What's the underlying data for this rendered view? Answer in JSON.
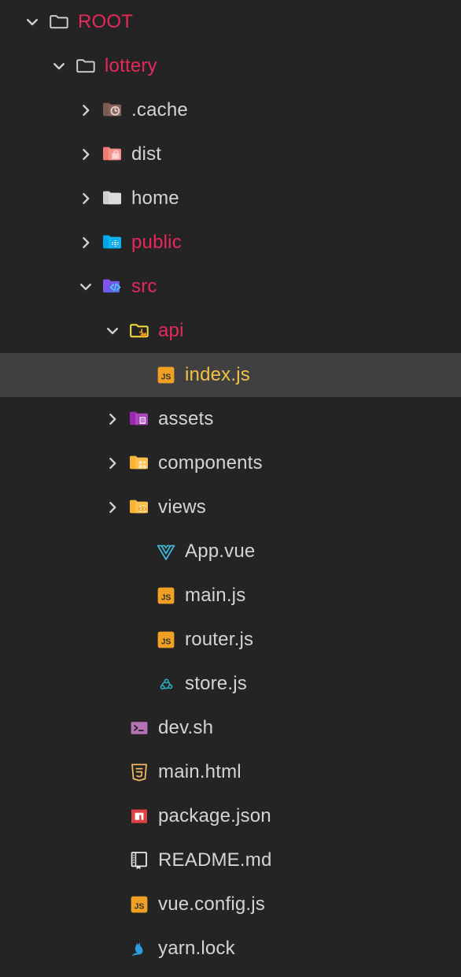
{
  "theme": {
    "background": "#242424",
    "selected_row_background": "#403f42",
    "default_text": "#d4d4d4",
    "folder_text": "#e8275a",
    "selected_file_text": "#f0c244"
  },
  "tree": {
    "name": "file-explorer-tree",
    "rows": [
      {
        "label": "ROOT",
        "depth": 0,
        "kind": "folder",
        "expanded": true,
        "icon": "folder-outline-icon",
        "color": "pink",
        "selected": false
      },
      {
        "label": "lottery",
        "depth": 1,
        "kind": "folder",
        "expanded": true,
        "icon": "folder-outline-icon",
        "color": "pink",
        "selected": false
      },
      {
        "label": ".cache",
        "depth": 2,
        "kind": "folder",
        "expanded": false,
        "icon": "folder-cache-icon",
        "color": "default",
        "selected": false
      },
      {
        "label": "dist",
        "depth": 2,
        "kind": "folder",
        "expanded": false,
        "icon": "folder-dist-icon",
        "color": "default",
        "selected": false
      },
      {
        "label": "home",
        "depth": 2,
        "kind": "folder",
        "expanded": false,
        "icon": "folder-plain-icon",
        "color": "default",
        "selected": false
      },
      {
        "label": "public",
        "depth": 2,
        "kind": "folder",
        "expanded": false,
        "icon": "folder-public-icon",
        "color": "pink",
        "selected": false
      },
      {
        "label": "src",
        "depth": 2,
        "kind": "folder",
        "expanded": true,
        "icon": "folder-src-icon",
        "color": "pink",
        "selected": false
      },
      {
        "label": "api",
        "depth": 3,
        "kind": "folder",
        "expanded": true,
        "icon": "folder-api-icon",
        "color": "pink",
        "selected": false
      },
      {
        "label": "index.js",
        "depth": 4,
        "kind": "file",
        "expanded": null,
        "icon": "javascript-file-icon",
        "color": "gold",
        "selected": true
      },
      {
        "label": "assets",
        "depth": 3,
        "kind": "folder",
        "expanded": false,
        "icon": "folder-assets-icon",
        "color": "default",
        "selected": false
      },
      {
        "label": "components",
        "depth": 3,
        "kind": "folder",
        "expanded": false,
        "icon": "folder-components-icon",
        "color": "default",
        "selected": false
      },
      {
        "label": "views",
        "depth": 3,
        "kind": "folder",
        "expanded": false,
        "icon": "folder-views-icon",
        "color": "default",
        "selected": false
      },
      {
        "label": "App.vue",
        "depth": 4,
        "kind": "file",
        "expanded": null,
        "icon": "vue-file-icon",
        "color": "default",
        "selected": false
      },
      {
        "label": "main.js",
        "depth": 4,
        "kind": "file",
        "expanded": null,
        "icon": "javascript-file-icon",
        "color": "default",
        "selected": false
      },
      {
        "label": "router.js",
        "depth": 4,
        "kind": "file",
        "expanded": null,
        "icon": "javascript-file-icon",
        "color": "default",
        "selected": false
      },
      {
        "label": "store.js",
        "depth": 4,
        "kind": "file",
        "expanded": null,
        "icon": "redux-file-icon",
        "color": "default",
        "selected": false
      },
      {
        "label": "dev.sh",
        "depth": 3,
        "kind": "file",
        "expanded": null,
        "icon": "shell-script-file-icon",
        "color": "default",
        "selected": false
      },
      {
        "label": "main.html",
        "depth": 3,
        "kind": "file",
        "expanded": null,
        "icon": "html5-file-icon",
        "color": "default",
        "selected": false
      },
      {
        "label": "package.json",
        "depth": 3,
        "kind": "file",
        "expanded": null,
        "icon": "npm-package-file-icon",
        "color": "default",
        "selected": false
      },
      {
        "label": "README.md",
        "depth": 3,
        "kind": "file",
        "expanded": null,
        "icon": "readme-book-file-icon",
        "color": "default",
        "selected": false
      },
      {
        "label": "vue.config.js",
        "depth": 3,
        "kind": "file",
        "expanded": null,
        "icon": "javascript-file-icon",
        "color": "default",
        "selected": false
      },
      {
        "label": "yarn.lock",
        "depth": 3,
        "kind": "file",
        "expanded": null,
        "icon": "yarn-file-icon",
        "color": "default",
        "selected": false
      }
    ]
  }
}
